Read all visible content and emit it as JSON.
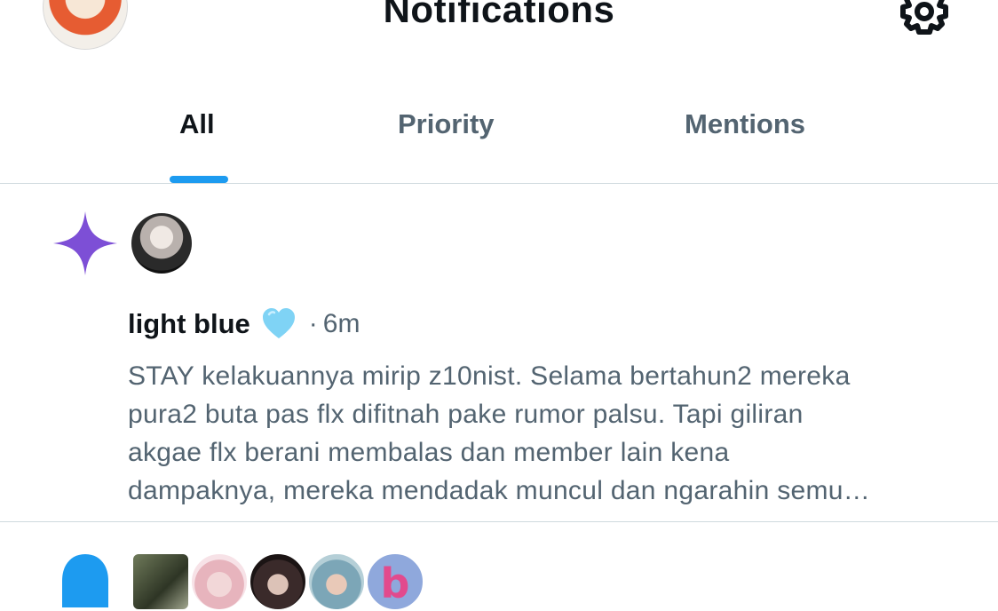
{
  "header": {
    "title": "Notifications",
    "settings_icon": "gear-icon",
    "avatar_icon": "profile-avatar"
  },
  "tabs": [
    {
      "label": "All",
      "active": true
    },
    {
      "label": "Priority",
      "active": false
    },
    {
      "label": "Mentions",
      "active": false
    }
  ],
  "colors": {
    "accent": "#1d9bf0",
    "text_primary": "#0f1419",
    "text_secondary": "#536471",
    "sparkle": "#7d4fd6",
    "heart": "#7fd3f5"
  },
  "notifications": [
    {
      "icon": "sparkle-icon",
      "author": "light blue",
      "emoji": "light-blue-heart",
      "separator": "·",
      "time": "6m",
      "text_lines": [
        "STAY kelakuannya mirip z10nist. Selama bertahun2 mereka",
        "pura2 buta pas flx difitnah pake rumor palsu. Tapi giliran",
        "akgae flx berani membalas dan member lain kena",
        "dampaknya, mereka mendadak muncul dan ngarahin semu…"
      ]
    },
    {
      "icon": "person-icon",
      "avatar_letter": "b"
    }
  ]
}
